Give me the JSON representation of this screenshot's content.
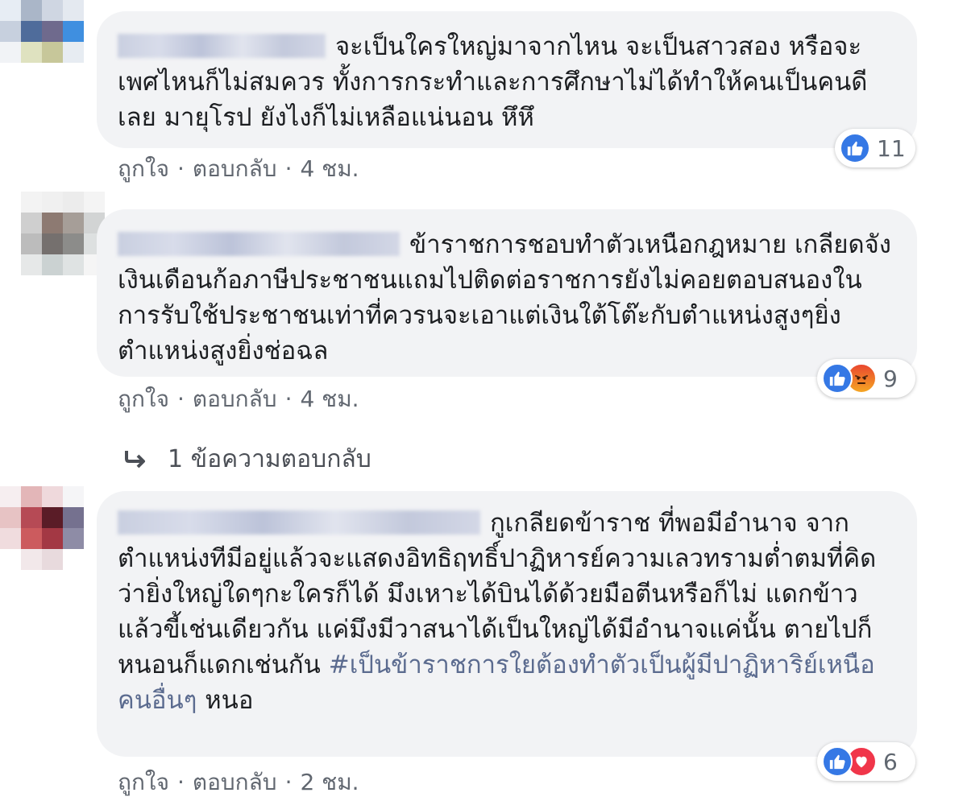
{
  "comments": [
    {
      "text": "จะเป็นใครใหญ่มาจากไหน จะเป็นสาวสอง หรือจะเพศไหนก็ไม่สมควร ทั้งการกระทำและการศึกษาไม่ได้ทำให้คนเป็นคนดีเลย มายุโรป ยังไงก็ไม่เหลือแน่นอน หึหึ",
      "like_label": "ถูกใจ",
      "reply_label": "ตอบกลับ",
      "time": "4 ชม.",
      "reactions": [
        "like-icon"
      ],
      "reaction_count": "11"
    },
    {
      "text": "ข้าราชการชอบทำตัวเหนือกฎหมาย เกลียดจังเงินเดือนก้อภาษีประชาชนแถมไปติดต่อราชการยังไม่คอยตอบสนองในการรับใช้ประชาชนเท่าที่ควรนจะเอาแต่เงินใต้โต๊ะกับตำแหน่งสูงๆยิ่งตำแหน่งสูงยิ่งช่อฉล",
      "like_label": "ถูกใจ",
      "reply_label": "ตอบกลับ",
      "time": "4 ชม.",
      "reactions": [
        "like-icon",
        "angry-icon"
      ],
      "reaction_count": "9",
      "replies_label": "1 ข้อความตอบกลับ"
    },
    {
      "text": "กูเกลียดข้าราช ที่พอมีอำนาจ จากตำแหน่งทีมีอยู่แล้วจะแสดงอิทธิฤทธิ์ปาฏิหารย์ความเลวทรามต่ำตมที่คิดว่ายิ่งใหญ่ใดๆกะใครก็ได้ มึงเหาะได้บินได้ด้วยมือตีนหรือก็ไม่ แดกข้าวแล้วขี้เช่นเดียวกัน แค่มึงมีวาสนาได้เป็นใหญ่ได้มีอำนาจแค่นั้น ตายไปก็หนอนก็แดกเช่นกัน",
      "hashtag": "#เป็นข้าราชการใยต้องทำตัวเป็นผู้มีปาฏิหาริย์เหนือคนอื่นๆ",
      "tail": "หนอ",
      "like_label": "ถูกใจ",
      "reply_label": "ตอบกลับ",
      "time": "2 ชม.",
      "reactions": [
        "like-icon",
        "love-icon"
      ],
      "reaction_count": "6"
    }
  ],
  "separator": "·",
  "colors": {
    "bubble": "#f2f3f5",
    "meta_text": "#616770",
    "like_blue": "#3578e5",
    "love_red": "#f0364a",
    "angry_orange": "#e9472f"
  }
}
